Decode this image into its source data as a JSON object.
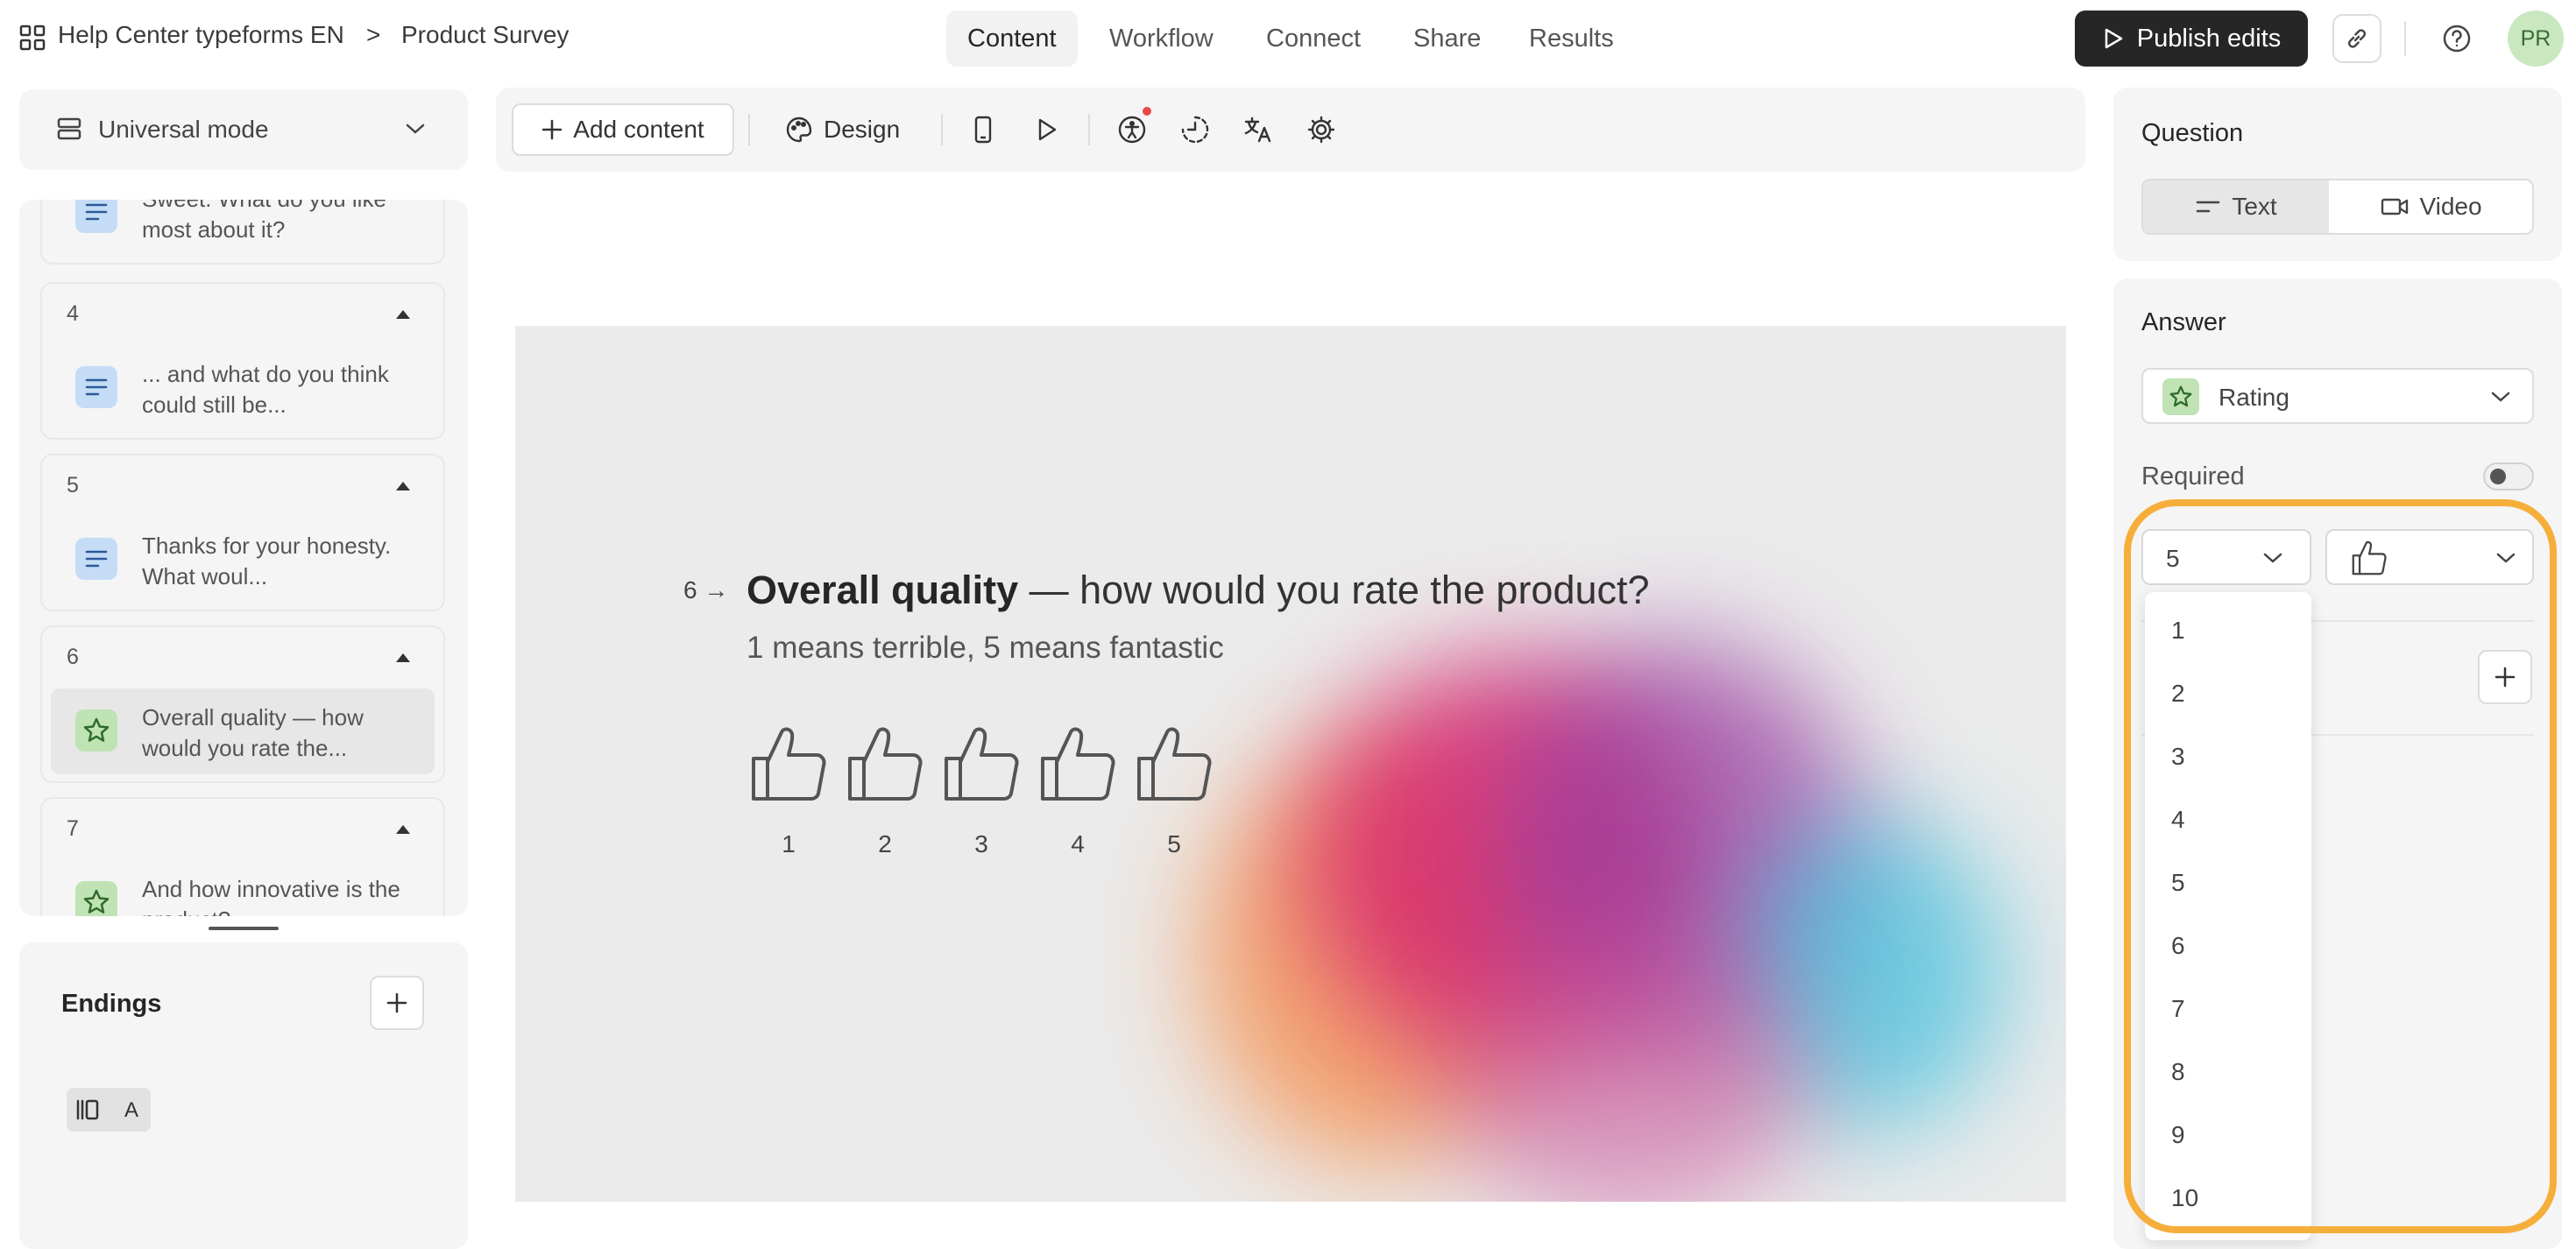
{
  "topbar": {
    "workspace": "Help Center typeforms EN",
    "separator": ">",
    "form_name": "Product Survey",
    "tabs": [
      {
        "label": "Content",
        "active": true
      },
      {
        "label": "Workflow",
        "active": false
      },
      {
        "label": "Connect",
        "active": false
      },
      {
        "label": "Share",
        "active": false
      },
      {
        "label": "Results",
        "active": false
      }
    ],
    "publish_label": "Publish edits",
    "avatar_initials": "PR"
  },
  "sidebar": {
    "mode_label": "Universal mode",
    "questions": [
      {
        "number": "",
        "text": "Sweet. What do you like most about it?",
        "type": "text"
      },
      {
        "number": "4",
        "text": "... and what do you think could still be...",
        "type": "text"
      },
      {
        "number": "5",
        "text": "Thanks for your honesty. What woul...",
        "type": "text"
      },
      {
        "number": "6",
        "text": "Overall quality — how would you rate the...",
        "type": "rating",
        "selected": true
      },
      {
        "number": "7",
        "text": "And how innovative is the product?",
        "type": "rating"
      }
    ],
    "endings_title": "Endings",
    "ending_badge": "A"
  },
  "toolbar": {
    "add_content_label": "Add content",
    "design_label": "Design"
  },
  "canvas": {
    "question_number": "6",
    "question_title_bold": "Overall quality",
    "question_title_rest": " — how would you rate the product?",
    "question_description": "1 means terrible, 5 means fantastic",
    "rating_labels": [
      "1",
      "2",
      "3",
      "4",
      "5"
    ]
  },
  "right_panel": {
    "question_heading": "Question",
    "question_types": [
      "Text",
      "Video"
    ],
    "answer_heading": "Answer",
    "answer_type": "Rating",
    "required_label": "Required",
    "required_on": false,
    "steps_value": "5",
    "steps_options": [
      "1",
      "2",
      "3",
      "4",
      "5",
      "6",
      "7",
      "8",
      "9",
      "10"
    ],
    "shape_icon": "thumbs-up-icon"
  },
  "colors": {
    "publish_bg": "#262627",
    "highlight": "#f6ae3b",
    "text_icon_bg": "#c5dcf7",
    "rating_icon_bg": "#bfe3b4"
  }
}
